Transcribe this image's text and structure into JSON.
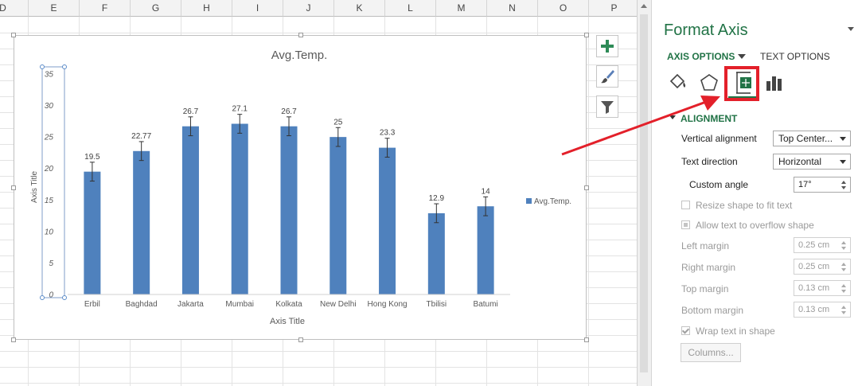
{
  "spreadsheet": {
    "column_headers": [
      "D",
      "E",
      "F",
      "G",
      "H",
      "I",
      "J",
      "K",
      "L",
      "M",
      "N",
      "O",
      "P"
    ]
  },
  "chart_data": {
    "type": "bar",
    "title": "Avg.Temp.",
    "categories": [
      "Erbil",
      "Baghdad",
      "Jakarta",
      "Mumbai",
      "Kolkata",
      "New Delhi",
      "Hong Kong",
      "Tbilisi",
      "Batumi"
    ],
    "series": [
      {
        "name": "Avg.Temp.",
        "values": [
          19.5,
          22.77,
          26.7,
          27.1,
          26.7,
          25,
          23.3,
          12.9,
          14
        ]
      }
    ],
    "data_labels": [
      "19.5",
      "22.77",
      "26.7",
      "27.1",
      "26.7",
      "25",
      "23.3",
      "12.9",
      "14"
    ],
    "xlabel": "Axis Title",
    "ylabel": "Axis Title",
    "ylim": [
      0,
      35
    ],
    "yticks": [
      0,
      5,
      10,
      15,
      20,
      25,
      30,
      35
    ],
    "error_bars": true,
    "legend_position": "right",
    "gridlines": false,
    "bar_color": "#4f81bd"
  },
  "chart_tools": {
    "add_element_icon": "plus-icon",
    "styles_icon": "paintbrush-icon",
    "filters_icon": "funnel-icon"
  },
  "format_pane": {
    "title": "Format Axis",
    "tabs": {
      "axis_options": "AXIS OPTIONS",
      "text_options": "TEXT OPTIONS"
    },
    "icons": [
      "fill-line-icon",
      "effects-pentagon-icon",
      "size-properties-icon",
      "axis-options-bar-icon"
    ],
    "section": "ALIGNMENT",
    "vertical_alignment": {
      "label": "Vertical alignment",
      "value": "Top Center..."
    },
    "text_direction": {
      "label": "Text direction",
      "value": "Horizontal"
    },
    "custom_angle": {
      "label": "Custom angle",
      "value": "17°"
    },
    "resize_shape": {
      "label": "Resize shape to fit text"
    },
    "allow_overflow": {
      "label": "Allow text to overflow shape"
    },
    "left_margin": {
      "label": "Left margin",
      "value": "0.25 cm"
    },
    "right_margin": {
      "label": "Right margin",
      "value": "0.25 cm"
    },
    "top_margin": {
      "label": "Top margin",
      "value": "0.13 cm"
    },
    "bottom_margin": {
      "label": "Bottom margin",
      "value": "0.13 cm"
    },
    "wrap_text": {
      "label": "Wrap text in shape"
    },
    "columns_button": "Columns...",
    "accent_color": "#217346"
  },
  "annotation": {
    "highlight_color": "#e3202a"
  }
}
